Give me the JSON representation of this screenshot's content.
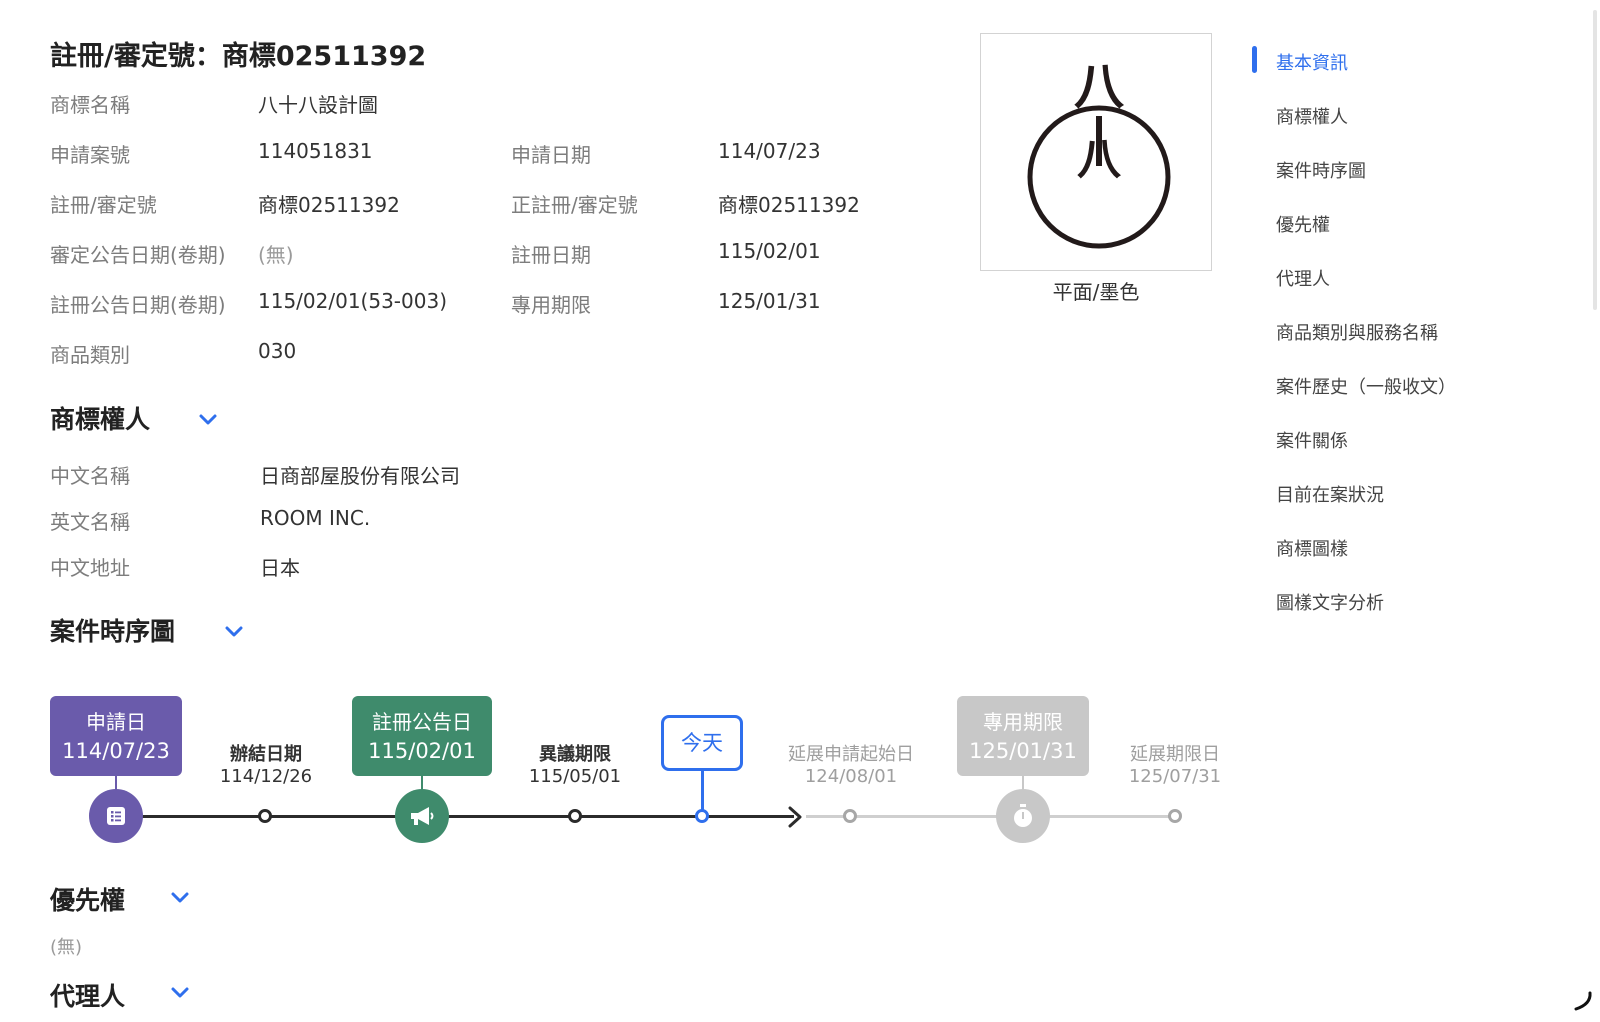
{
  "basic": {
    "title": "註冊/審定號：商標02511392",
    "rows": [
      {
        "label": "商標名稱",
        "value": "八十八設計圖"
      },
      {
        "label": "申請案號",
        "value": "114051831",
        "label2": "申請日期",
        "value2": "114/07/23"
      },
      {
        "label": "註冊/審定號",
        "value": "商標02511392",
        "label2": "正註冊/審定號",
        "value2": "商標02511392"
      },
      {
        "label": "審定公告日期(卷期)",
        "value": "(無)",
        "label2": "註冊日期",
        "value2": "115/02/01"
      },
      {
        "label": "註冊公告日期(卷期)",
        "value": "115/02/01(53-003)",
        "label2": "專用期限",
        "value2": "125/01/31"
      },
      {
        "label": "商品類別",
        "value": "030"
      }
    ]
  },
  "logo": {
    "glyph_top": "八",
    "glyph_mid": "十",
    "glyph_bottom": "八",
    "caption": "平面/墨色"
  },
  "owner": {
    "title": "商標權人",
    "rows": [
      {
        "label": "中文名稱",
        "value": "日商部屋股份有限公司"
      },
      {
        "label": "英文名稱",
        "value": "ROOM INC."
      },
      {
        "label": "中文地址",
        "value": "日本"
      }
    ]
  },
  "timeline": {
    "title": "案件時序圖",
    "today_label": "今天",
    "events": [
      {
        "title": "申請日",
        "date": "114/07/23",
        "status": "past"
      },
      {
        "title": "辦結日期",
        "date": "114/12/26",
        "status": "past"
      },
      {
        "title": "註冊公告日",
        "date": "115/02/01",
        "status": "past"
      },
      {
        "title": "異議期限",
        "date": "115/05/01",
        "status": "past"
      },
      {
        "title": "延展申請起始日",
        "date": "124/08/01",
        "status": "future"
      },
      {
        "title": "專用期限",
        "date": "125/01/31",
        "status": "future"
      },
      {
        "title": "延展期限日",
        "date": "125/07/31",
        "status": "future"
      }
    ]
  },
  "priority": {
    "title": "優先權",
    "empty": "(無)"
  },
  "agent": {
    "title": "代理人"
  },
  "nav": {
    "items": [
      {
        "label": "基本資訊",
        "active": true
      },
      {
        "label": "商標權人"
      },
      {
        "label": "案件時序圖"
      },
      {
        "label": "優先權"
      },
      {
        "label": "代理人"
      },
      {
        "label": "商品類別與服務名稱"
      },
      {
        "label": "案件歷史（一般收文）"
      },
      {
        "label": "案件關係"
      },
      {
        "label": "目前在案狀況"
      },
      {
        "label": "商標圖樣"
      },
      {
        "label": "圖樣文字分析"
      }
    ]
  },
  "colors": {
    "accent": "#2f6fed",
    "apply_purple": "#6a5bab",
    "announce_green": "#3f8b6c",
    "future_grey": "#c8c8c8"
  }
}
